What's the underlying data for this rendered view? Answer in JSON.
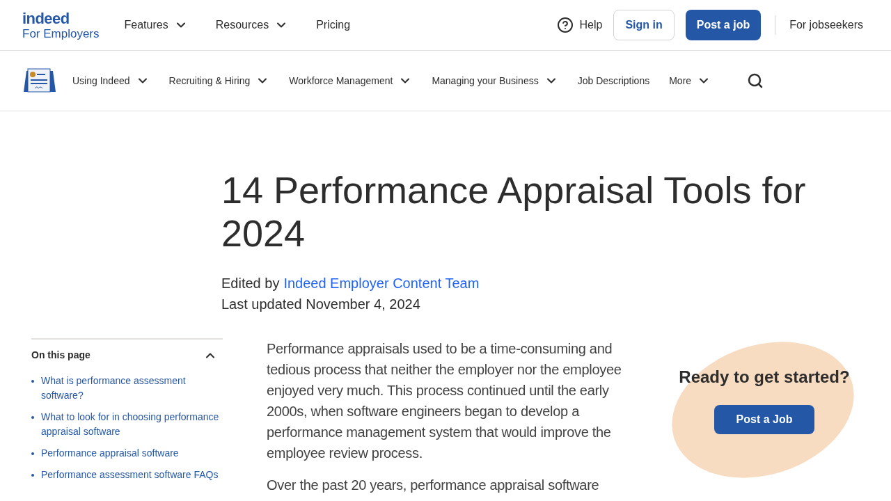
{
  "header": {
    "logo": {
      "wordmark": "indeed",
      "subtitle": "For Employers"
    },
    "nav": [
      {
        "label": "Features",
        "kind": "menu"
      },
      {
        "label": "Resources",
        "kind": "menu"
      },
      {
        "label": "Pricing",
        "kind": "link"
      }
    ],
    "help": "Help",
    "sign_in": "Sign in",
    "post_job": "Post a job",
    "jobseekers": "For jobseekers"
  },
  "subnav": [
    {
      "label": "Using Indeed",
      "kind": "menu"
    },
    {
      "label": "Recruiting & Hiring",
      "kind": "menu"
    },
    {
      "label": "Workforce Management",
      "kind": "menu"
    },
    {
      "label": "Managing your Business",
      "kind": "menu"
    },
    {
      "label": "Job Descriptions",
      "kind": "link"
    },
    {
      "label": "More",
      "kind": "menu"
    }
  ],
  "article": {
    "title": "14 Performance Appraisal Tools for 2024",
    "edited_by": "Edited by",
    "author": "Indeed Employer Content Team",
    "updated": "Last updated November 4, 2024",
    "paragraphs": [
      "Performance appraisals used to be a time-consuming and tedious process that neither the employer nor the employee enjoyed very much. This process continued until the early 2000s, when software engineers began to develop a performance management system that would improve the employee review process.",
      "Over the past 20 years, performance appraisal software"
    ]
  },
  "toc": {
    "title": "On this page",
    "expanded": true,
    "items": [
      "What is performance assessment software?",
      "What to look for in choosing performance appraisal software",
      "Performance appraisal software",
      "Performance assessment software FAQs"
    ]
  },
  "cta": {
    "title": "Ready to get started?",
    "button": "Post a Job"
  }
}
